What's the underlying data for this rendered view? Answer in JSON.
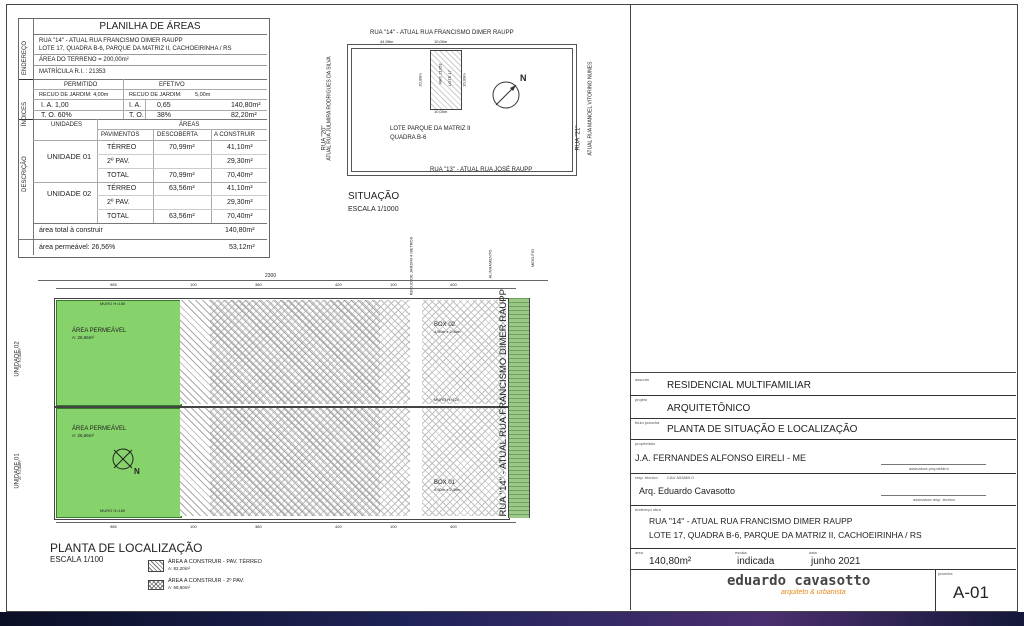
{
  "areas_table": {
    "title": "PLANILHA DE ÁREAS",
    "side_labels": {
      "endereco": "ENDEREÇO",
      "indices": "ÍNDICES",
      "descricao": "DESCRIÇÃO"
    },
    "address_line1": "RUA \"14\" - ATUAL RUA FRANCISMO DIMER RAUPP",
    "address_line2": "LOTE 17, QUADRA B-6, PARQUE DA MATRIZ II, CACHOEIRINHA / RS",
    "land_area": "ÁREA DO TERRENO = 200,00m²",
    "registration": "MATRÍCULA  R.I. :   21353",
    "indices": {
      "permitido": "PERMITIDO",
      "efetivo": "EFETIVO",
      "recuo_permitido": "RECUO DE JARDIM: 4,00m",
      "recuo_efetivo": "RECUO  DE JARDIM:",
      "recuo_efetivo_val": "5,00m",
      "ia_perm": "I. A.   1,00",
      "ia_lbl": "I. A.",
      "ia_ef": "0,65",
      "ia_area": "140,80m²",
      "to_perm": "T. O. 60%",
      "to_lbl": "T. O.",
      "to_ef": "38%",
      "to_area": "82,20m²"
    },
    "headers": {
      "unidades": "UNIDADES",
      "areas": "ÁREAS",
      "pavimentos": "PAVIMENTOS",
      "descoberta": "DESCOBERTA",
      "a_construir": "A CONSTRUIR"
    },
    "units": [
      {
        "name": "UNIDADE 01",
        "rows": [
          {
            "pav": "TÉRREO",
            "desc": "70,99m²",
            "constr": "41,10m²"
          },
          {
            "pav": "2º PAV.",
            "desc": "",
            "constr": "29,30m²"
          },
          {
            "pav": "TOTAL",
            "desc": "70,99m²",
            "constr": "70,40m²"
          }
        ]
      },
      {
        "name": "UNIDADE 02",
        "rows": [
          {
            "pav": "TÉRREO",
            "desc": "63,56m²",
            "constr": "41,10m²"
          },
          {
            "pav": "2º PAV.",
            "desc": "",
            "constr": "29,30m²"
          },
          {
            "pav": "TOTAL",
            "desc": "63,56m²",
            "constr": "70,40m²"
          }
        ]
      }
    ],
    "total_label": "área total  à construir",
    "total_value": "140,80m²",
    "permeavel_label": "área permeável: 26,56%",
    "permeavel_value": "53,12m²"
  },
  "situacao": {
    "street_top": "RUA \"14\" - ATUAL RUA FRANCISMO DIMER RAUPP",
    "street_bottom": "RUA \"13\" - ATUAL RUA JOSÉ RAUPP",
    "street_left_1": "RUA \"20\"",
    "street_left_2": "ATUAL RUA JULMIRA RODRIGUES DA SILVA",
    "street_right_1": "RUA \"21\"",
    "street_right_2": "ATUAL RUA MANOEL VITORINO NUNES",
    "dim_left": "44,98m",
    "dim_front": "10,00m",
    "dim_back": "10,00m",
    "dim_side_l": "20,00m",
    "dim_side_r": "20,00m",
    "lot_label_1": "MAT. 21353",
    "lot_label_2": "LOTE 17",
    "lot_name_1": "LOTE  PARQUE DA MATRIZ II",
    "lot_name_2": "QUADRA B-6",
    "north": "N",
    "title": "SITUAÇÃO",
    "scale": "ESCALA 1/1000"
  },
  "localizacao": {
    "title": "PLANTA DE LOCALIZAÇÃO",
    "scale": "ESCALA 1/100",
    "street": "RUA \"14\" - ATUAL RUA FRANCISMO DIMER RAUPP",
    "total_dim": "2300",
    "top_dims": [
      "985",
      "100",
      "380",
      "420",
      "100",
      "400"
    ],
    "bottom_dims": [
      "985",
      "100",
      "380",
      "420",
      "100",
      "400"
    ],
    "recuo_label": "RECUO DE JARDIM\n4 METROS",
    "alinhamento": "ALINHAMENTO",
    "meio_fio": "MEIO-FIO",
    "unit02_side": "UNIDADE 02",
    "unit02_area": "A: 70,40m²",
    "unit01_side": "UNIDADE 01",
    "unit01_area": "A: 70,40m²",
    "perm_label": "ÁREA PERMEÁVEL",
    "perm02_area": "A: 26,56m²",
    "perm01_area": "A: 26,56m²",
    "box02": "BOX 02",
    "box02_dims": "4,50m x 2,40m",
    "box01": "BOX 01",
    "box01_dims": "4,50m x 2,40m",
    "muro": "MURO H=180",
    "muro_mid": "MURO H=120",
    "north": "N",
    "legend_terreo_1": "ÁREA A CONSTRUIR - PAV. TÉRREO",
    "legend_terreo_2": "A: 82,20m²",
    "legend_2pav_1": "ÁREA A CONSTRUIR - 2º PAV.",
    "legend_2pav_2": "A: 58,60m²"
  },
  "title_block": {
    "lbl_assunto": "assunto",
    "assunto": "RESIDENCIAL MULTIFAMILIAR",
    "lbl_projeto": "projeto",
    "projeto": "ARQUITETÔNICO",
    "lbl_titulo": "título prancha",
    "titulo": "PLANTA DE SITUAÇÃO E LOCALIZAÇÃO",
    "lbl_proprietario": "proprietário",
    "proprietario": "J.A. FERNANDES ALFONSO EIRELI - ME",
    "assinatura_prop": "assinatura proprietário",
    "lbl_resp": "resp. técnico",
    "cau": "CAU A53869-0",
    "resp": "Arq. Eduardo Cavasotto",
    "assinatura_resp": "assinatura resp. técnico",
    "lbl_endereco": "endereço obra",
    "endereco_1": "RUA \"14\" - ATUAL RUA FRANCISMO DIMER RAUPP",
    "endereco_2": "LOTE 17, QUADRA B-6, PARQUE DA MATRIZ II, CACHOEIRINHA / RS",
    "lbl_area": "área",
    "area": "140,80m²",
    "lbl_escala": "escala",
    "escala": "indicada",
    "lbl_data": "data",
    "data": "junho 2021",
    "logo_1": "eduardo cavasotto",
    "logo_2": "arquiteto & urbanista",
    "lbl_prancha": "prancha",
    "prancha": "A-01"
  },
  "colors": {
    "perm_green": "#86d36b",
    "logo_orange": "#e8891b",
    "line": "#333333"
  }
}
